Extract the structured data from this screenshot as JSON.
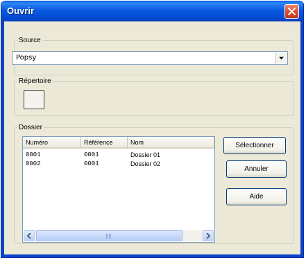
{
  "window": {
    "title": "Ouvrir",
    "close_icon": "close-icon"
  },
  "source": {
    "legend": "Source",
    "selected": "Popsy"
  },
  "repertoire": {
    "legend": "Répertoire"
  },
  "dossier": {
    "legend": "Dossier",
    "columns": [
      "Numéro",
      "Référence",
      "Nom"
    ],
    "rows": [
      {
        "numero": "0001",
        "reference": "0001",
        "nom": "Dossier 01"
      },
      {
        "numero": "0002",
        "reference": "0001",
        "nom": "Dossier 02"
      }
    ]
  },
  "buttons": {
    "selectionner": "Sélectionner",
    "annuler": "Annuler",
    "aide": "Aide"
  }
}
